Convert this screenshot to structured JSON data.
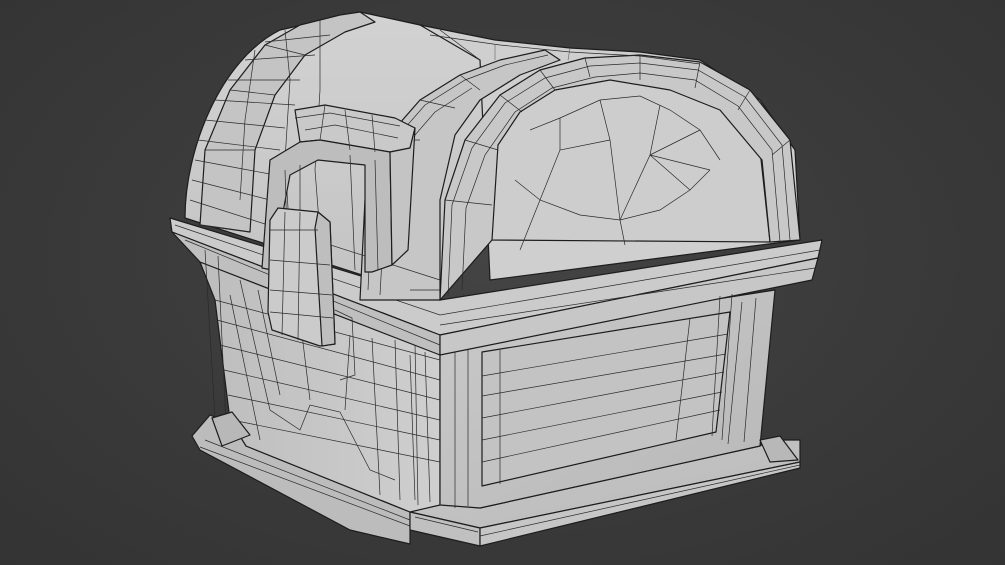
{
  "viewport": {
    "background_color": "#3b3b3b",
    "mesh_color": "#c4c4c4",
    "wire_color": "#222222"
  },
  "object": {
    "icon": "treasure-chest-wireframe"
  }
}
